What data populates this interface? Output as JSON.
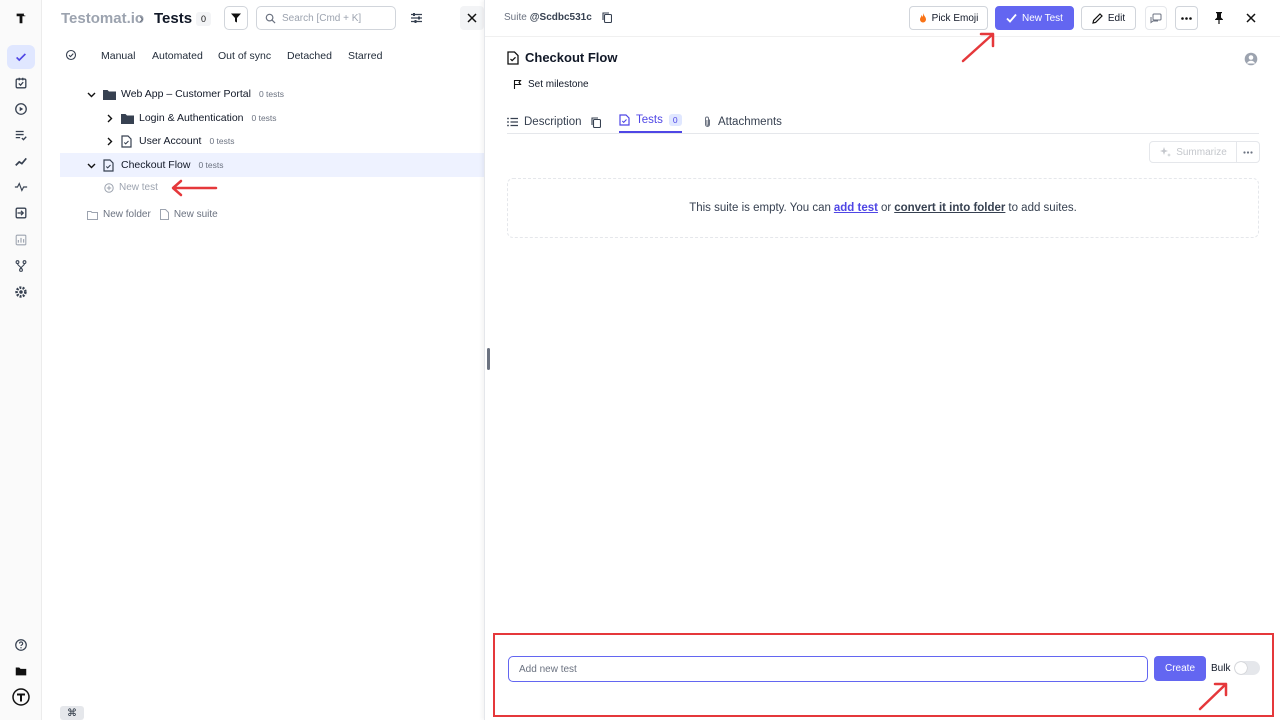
{
  "colors": {
    "accent": "#6366f1",
    "annotation": "#e5383b",
    "selected_row": "#eef2ff"
  },
  "header": {
    "app_name": "Testomat.io",
    "separator": "›",
    "page_title": "Tests",
    "tests_count": "0",
    "search_placeholder": "Search [Cmd + K]"
  },
  "filters": [
    "Manual",
    "Automated",
    "Out of sync",
    "Detached",
    "Starred"
  ],
  "tree": {
    "items": [
      {
        "label": "Web App – Customer Portal",
        "count": "0 tests",
        "icon": "folder-icon",
        "chevron": "down"
      },
      {
        "label": "Login & Authentication",
        "count": "0 tests",
        "icon": "folder-icon",
        "chevron": "right"
      },
      {
        "label": "User Account",
        "count": "0 tests",
        "icon": "suite-file-icon",
        "chevron": "right"
      },
      {
        "label": "Checkout Flow",
        "count": "0 tests",
        "icon": "suite-file-icon",
        "chevron": "down"
      }
    ],
    "new_test": "New test",
    "new_folder": "New folder",
    "new_suite": "New suite"
  },
  "keyboard_hint": "⌘",
  "detail": {
    "suite_label": "Suite",
    "suite_id": "@Scdbc531c",
    "buttons": {
      "pick_emoji": "Pick Emoji",
      "new_test": "New Test",
      "edit": "Edit"
    },
    "title": "Checkout Flow",
    "set_milestone": "Set milestone",
    "tabs": {
      "description": "Description",
      "tests": "Tests",
      "tests_count": "0",
      "attachments": "Attachments"
    },
    "summarize": "Summarize",
    "empty": {
      "prefix": "This suite is empty. You can",
      "add_test_link": "add test",
      "middle": "or",
      "convert_link": "convert it into folder",
      "suffix": "to add suites."
    },
    "add_bar": {
      "placeholder": "Add new test",
      "create": "Create",
      "bulk": "Bulk",
      "bulk_enabled": false
    }
  }
}
